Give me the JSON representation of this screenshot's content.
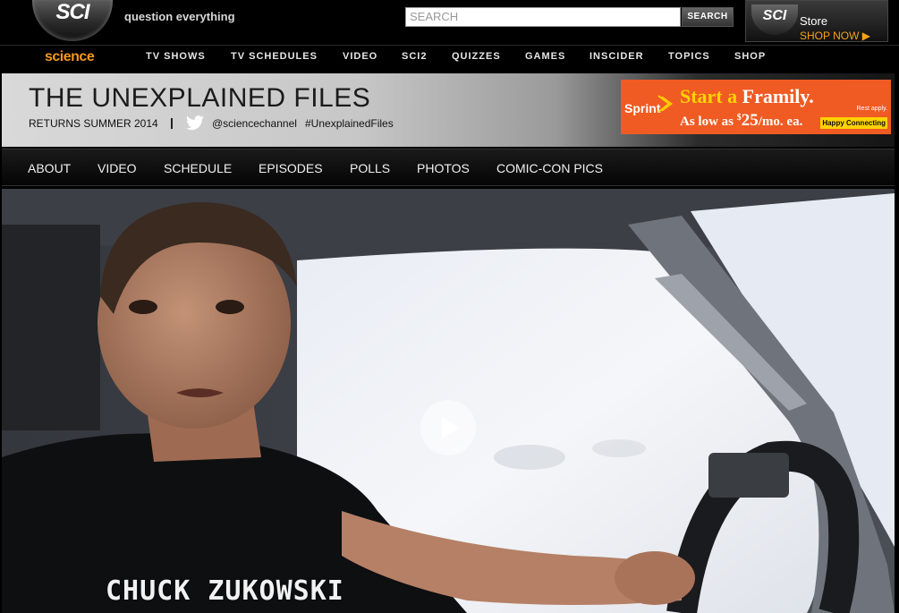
{
  "site": {
    "logo_text": "SCI",
    "tagline": "question everything",
    "brand": "science"
  },
  "search": {
    "placeholder": "SEARCH",
    "button_label": "SEARCH"
  },
  "store": {
    "logo_text": "SCI",
    "label": "Store",
    "cta": "SHOP NOW ▶"
  },
  "main_nav": [
    {
      "label": "TV SHOWS"
    },
    {
      "label": "TV SCHEDULES"
    },
    {
      "label": "VIDEO"
    },
    {
      "label": "SCI2"
    },
    {
      "label": "QUIZZES"
    },
    {
      "label": "GAMES"
    },
    {
      "label": "INSCIDER"
    },
    {
      "label": "TOPICS"
    },
    {
      "label": "SHOP"
    }
  ],
  "show": {
    "title": "THE UNEXPLAINED FILES",
    "returns": "RETURNS SUMMER 2014",
    "twitter_handle": "@sciencechannel",
    "hashtag": "#UnexplainedFiles"
  },
  "ad": {
    "brand": "Sprint",
    "headline_a": "Start a ",
    "headline_b": "Framily.",
    "sub_a": "As low as ",
    "sub_dollar": "$",
    "sub_price": "25",
    "sub_b": "/mo. ea.",
    "fine_print": "Rest apply.",
    "badge": "Happy Connecting"
  },
  "sub_nav": [
    {
      "label": "ABOUT"
    },
    {
      "label": "VIDEO"
    },
    {
      "label": "SCHEDULE"
    },
    {
      "label": "EPISODES"
    },
    {
      "label": "POLLS"
    },
    {
      "label": "PHOTOS"
    },
    {
      "label": "COMIC-CON PICS"
    }
  ],
  "video": {
    "caption": "CHUCK ZUKOWSKI"
  },
  "colors": {
    "brand_orange": "#f39a1e",
    "ad_orange": "#ef5b23",
    "ad_yellow": "#ffd200",
    "twitter_blue": "#ffffff"
  }
}
